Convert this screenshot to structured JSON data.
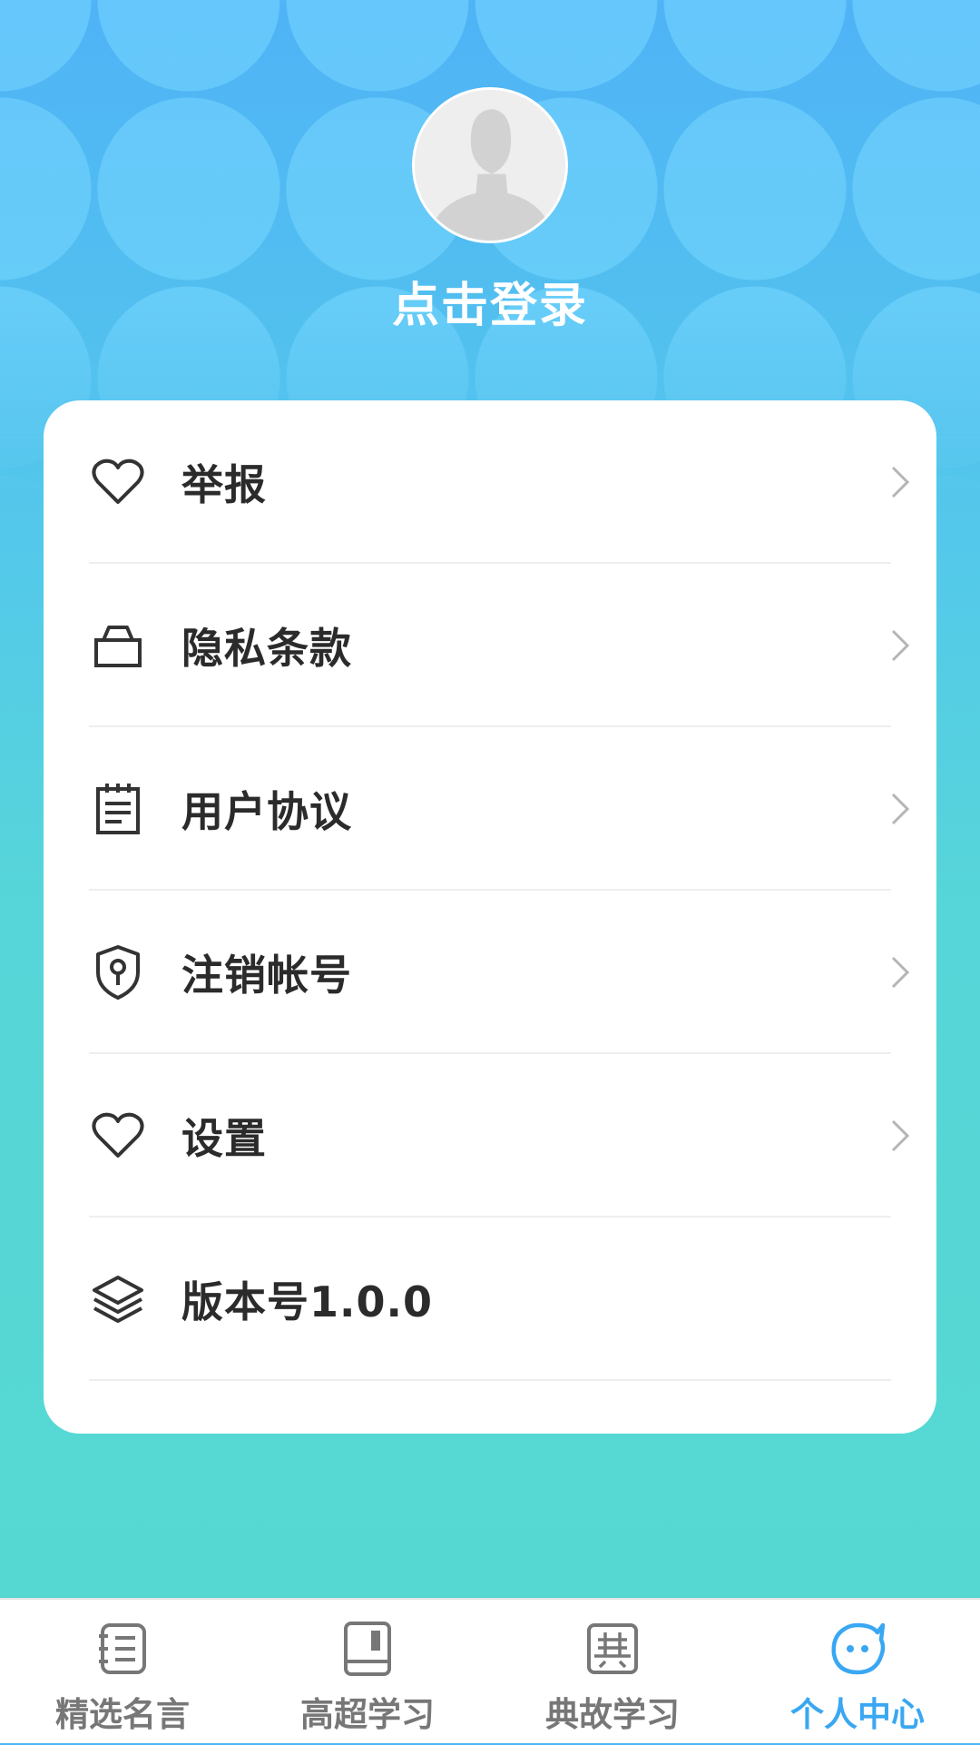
{
  "header": {
    "login_label": "点击登录"
  },
  "menu": {
    "items": [
      {
        "label": "举报",
        "icon": "heart-icon",
        "chevron": true
      },
      {
        "label": "隐私条款",
        "icon": "bag-icon",
        "chevron": true
      },
      {
        "label": "用户协议",
        "icon": "notepad-icon",
        "chevron": true
      },
      {
        "label": "注销帐号",
        "icon": "shield-icon",
        "chevron": true
      },
      {
        "label": "设置",
        "icon": "heart-icon",
        "chevron": true
      },
      {
        "label": "版本号1.0.0",
        "icon": "layers-icon",
        "chevron": false
      }
    ]
  },
  "tabbar": {
    "tabs": [
      {
        "label": "精选名言",
        "icon": "notebook-icon",
        "active": false
      },
      {
        "label": "高超学习",
        "icon": "book-icon",
        "active": false
      },
      {
        "label": "典故学习",
        "icon": "dian-seal-icon",
        "active": false
      },
      {
        "label": "个人中心",
        "icon": "face-bubble-icon",
        "active": true
      }
    ]
  },
  "colors": {
    "accent": "#3aa7f2",
    "bg_top": "#4fb3f6",
    "bg_bottom": "#56d8d2",
    "inactive_tab": "#777777",
    "text": "#2b2b2b"
  }
}
